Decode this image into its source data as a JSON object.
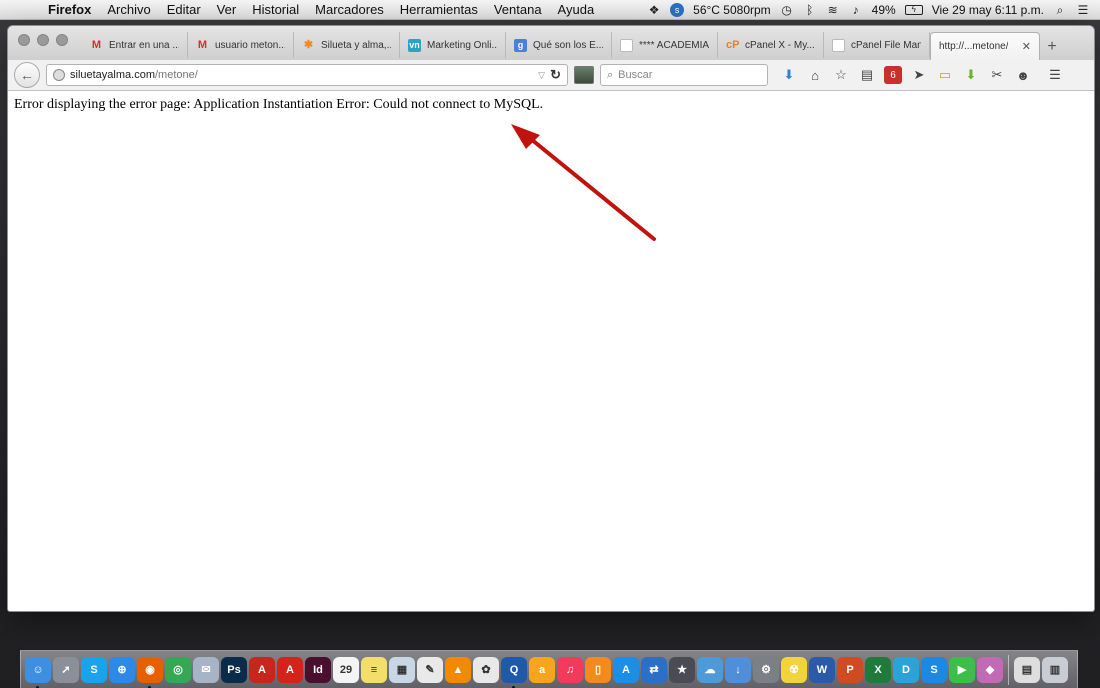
{
  "menubar": {
    "apple_icon": "apple-icon",
    "app_name": "Firefox",
    "menus": [
      "Archivo",
      "Editar",
      "Ver",
      "Historial",
      "Marcadores",
      "Herramientas",
      "Ventana",
      "Ayuda"
    ],
    "status": {
      "temperature": "56°C 5080rpm",
      "battery": "49%",
      "datetime": "Vie 29 may  6:11 p.m."
    }
  },
  "tabs": [
    {
      "label": "Entrar en una ...",
      "icon": "gmail-icon",
      "color": "#d93025",
      "glyph": "M"
    },
    {
      "label": "usuario meton...",
      "icon": "gmail-icon",
      "color": "#d93025",
      "glyph": "M"
    },
    {
      "label": "Silueta y alma,...",
      "icon": "joomla-icon",
      "color": "#f08a24",
      "glyph": "✱"
    },
    {
      "label": "Marketing Onli...",
      "icon": "vn-icon",
      "color": "#29a3c7",
      "glyph": "vn"
    },
    {
      "label": "Qué son los E...",
      "icon": "google-icon",
      "color": "#4a7fe0",
      "glyph": "g"
    },
    {
      "label": "**** ACADEMIA LA...",
      "icon": "blank-icon",
      "color": "#e0e0e0",
      "glyph": ""
    },
    {
      "label": "cPanel X - My...",
      "icon": "cpanel-icon",
      "color": "#f07f1a",
      "glyph": "cP"
    },
    {
      "label": "cPanel File Manag...",
      "icon": "blank-icon",
      "color": "#e0e0e0",
      "glyph": ""
    },
    {
      "label": "http://...metone/",
      "icon": "none",
      "color": "",
      "glyph": "",
      "active": true
    }
  ],
  "address": {
    "host": "siluetayalma.com",
    "path": "/metone/"
  },
  "search": {
    "placeholder": "Buscar"
  },
  "page": {
    "error_message": "Error displaying the error page: Application Instantiation Error: Could not connect to MySQL."
  },
  "annotation": {
    "arrow_color": "#c0130c"
  },
  "dock": [
    {
      "name": "finder-icon",
      "color": "#3f8fe0",
      "glyph": "☺",
      "running": true
    },
    {
      "name": "launchpad-icon",
      "color": "#8b8f99",
      "glyph": "➚"
    },
    {
      "name": "skype-icon",
      "color": "#1aa3e8",
      "glyph": "S"
    },
    {
      "name": "safari-icon",
      "color": "#2d89e5",
      "glyph": "⊕"
    },
    {
      "name": "firefox-icon",
      "color": "#e66000",
      "glyph": "◉",
      "running": true
    },
    {
      "name": "chrome-icon",
      "color": "#34a853",
      "glyph": "◎"
    },
    {
      "name": "mail-icon",
      "color": "#a7b3c6",
      "glyph": "✉"
    },
    {
      "name": "photoshop-icon",
      "color": "#0a2b4a",
      "glyph": "Ps"
    },
    {
      "name": "acrobat-icon",
      "color": "#c6261c",
      "glyph": "A"
    },
    {
      "name": "acrobat-reader-icon",
      "color": "#d5231c",
      "glyph": "A"
    },
    {
      "name": "indesign-icon",
      "color": "#4a0f2e",
      "glyph": "Id"
    },
    {
      "name": "calendar-icon",
      "color": "#f4f4f4",
      "glyph": "29"
    },
    {
      "name": "notes-icon",
      "color": "#f2de6a",
      "glyph": "≡"
    },
    {
      "name": "preview-icon",
      "color": "#c9d6e6",
      "glyph": "▦"
    },
    {
      "name": "textedit-icon",
      "color": "#e9e9e9",
      "glyph": "✎"
    },
    {
      "name": "vlc-icon",
      "color": "#f18a00",
      "glyph": "▲"
    },
    {
      "name": "photos-icon",
      "color": "#e8e8e8",
      "glyph": "✿"
    },
    {
      "name": "quicktime-icon",
      "color": "#1e5aa8",
      "glyph": "Q",
      "running": true
    },
    {
      "name": "amazon-icon",
      "color": "#f7a51c",
      "glyph": "a"
    },
    {
      "name": "itunes-icon",
      "color": "#f23b5c",
      "glyph": "♫"
    },
    {
      "name": "ibooks-icon",
      "color": "#f38a1c",
      "glyph": "▯"
    },
    {
      "name": "app-store-icon",
      "color": "#1b8ee8",
      "glyph": "A"
    },
    {
      "name": "migration-icon",
      "color": "#2d6fc4",
      "glyph": "⇄"
    },
    {
      "name": "imovie-icon",
      "color": "#4b4b55",
      "glyph": "★"
    },
    {
      "name": "network-icon",
      "color": "#4e9ad8",
      "glyph": "☁"
    },
    {
      "name": "downloads-icon",
      "color": "#4f8fd9",
      "glyph": "↓"
    },
    {
      "name": "system-prefs-icon",
      "color": "#7d7f86",
      "glyph": "⚙"
    },
    {
      "name": "radiation-icon",
      "color": "#f0d43a",
      "glyph": "☢"
    },
    {
      "name": "word-icon",
      "color": "#2b5aa8",
      "glyph": "W"
    },
    {
      "name": "powerpoint-icon",
      "color": "#d04a22",
      "glyph": "P"
    },
    {
      "name": "excel-icon",
      "color": "#1f7a3c",
      "glyph": "X"
    },
    {
      "name": "dashlane-icon",
      "color": "#2aa3d6",
      "glyph": "D"
    },
    {
      "name": "shazam-icon",
      "color": "#1c88e0",
      "glyph": "S"
    },
    {
      "name": "facetime-icon",
      "color": "#3dbe4a",
      "glyph": "▶"
    },
    {
      "name": "keynote-icon",
      "color": "#c16ab6",
      "glyph": "◆"
    },
    {
      "name": "documents-icon",
      "color": "#dedede",
      "glyph": "▤"
    },
    {
      "name": "trash-icon",
      "color": "#c9ccd2",
      "glyph": "▥"
    }
  ]
}
